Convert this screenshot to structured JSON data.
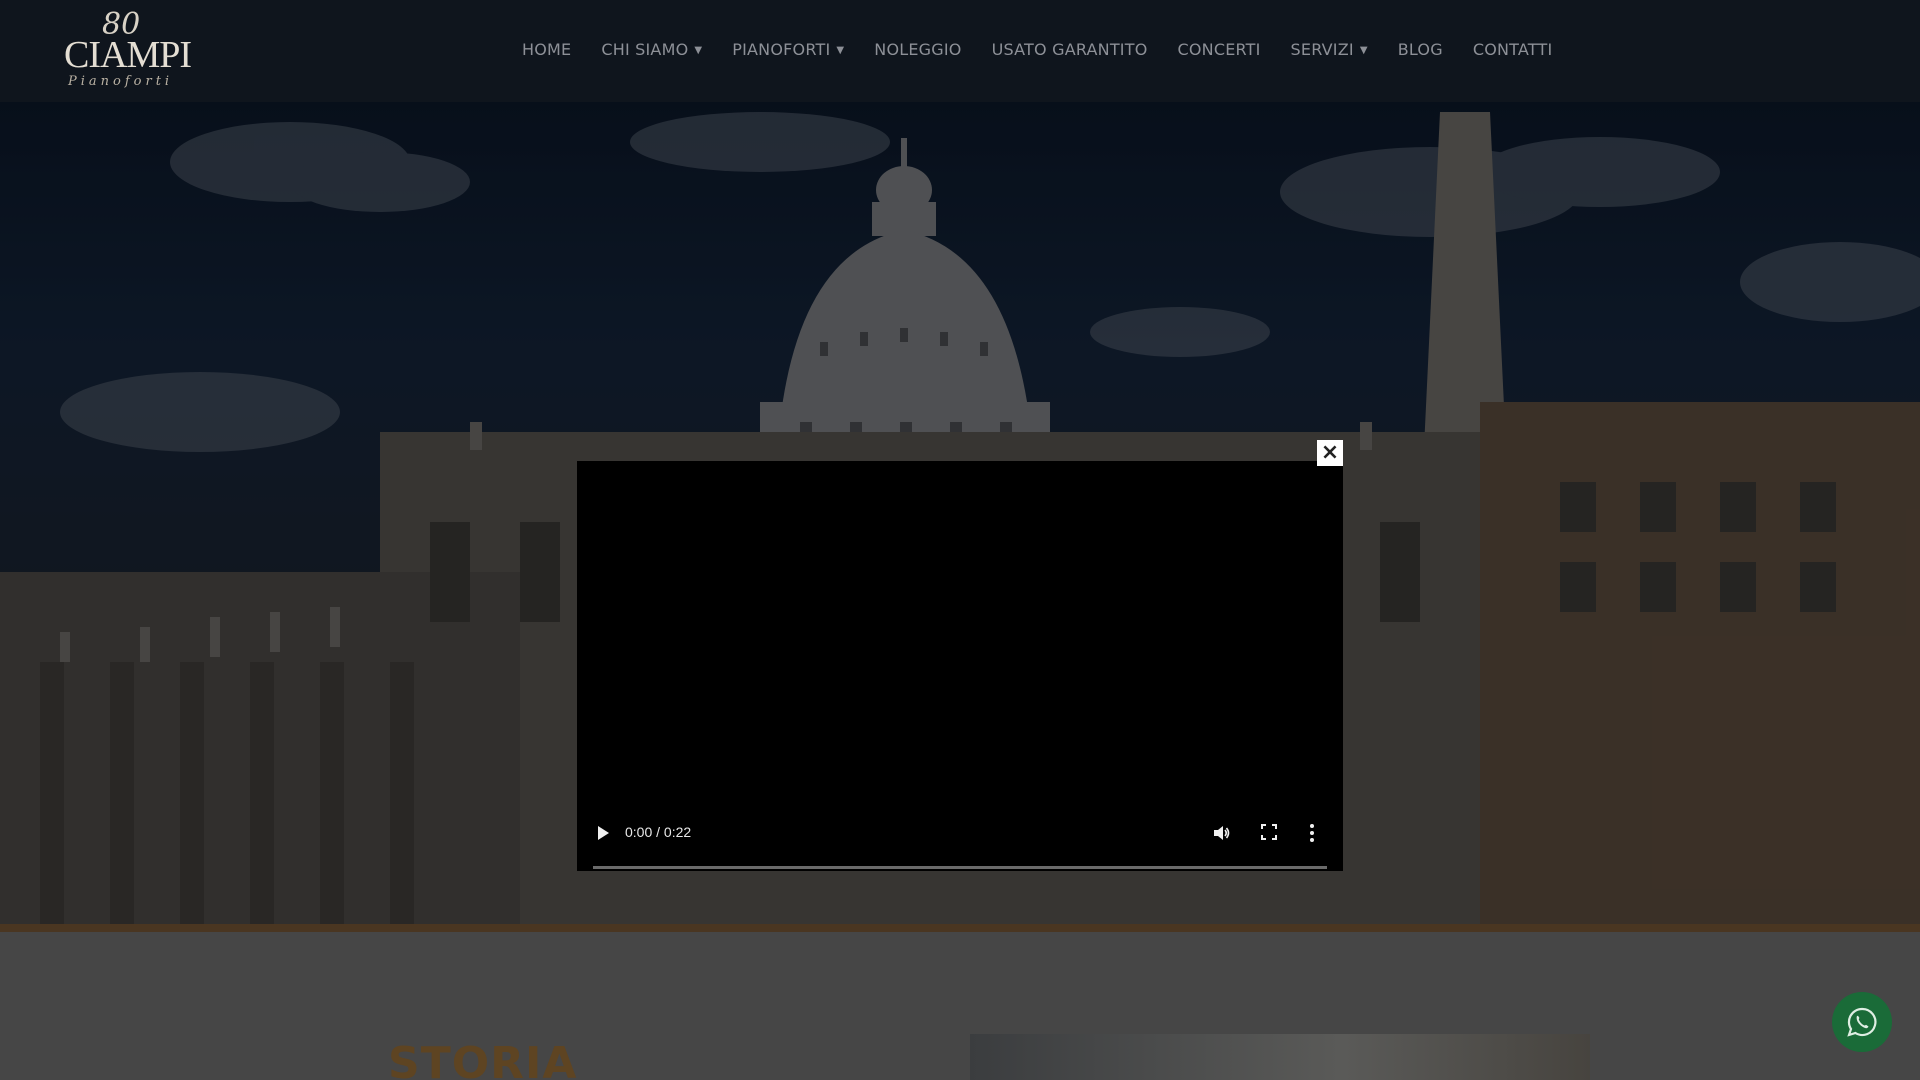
{
  "brand": {
    "logo_number": "80",
    "logo_name": "CIAMPI",
    "logo_subtitle": "Pianoforti"
  },
  "nav": {
    "items": [
      {
        "label": "HOME",
        "has_dropdown": false
      },
      {
        "label": "CHI SIAMO",
        "has_dropdown": true
      },
      {
        "label": "PIANOFORTI",
        "has_dropdown": true
      },
      {
        "label": "NOLEGGIO",
        "has_dropdown": false
      },
      {
        "label": "USATO GARANTITO",
        "has_dropdown": false
      },
      {
        "label": "CONCERTI",
        "has_dropdown": false
      },
      {
        "label": "SERVIZI",
        "has_dropdown": true
      },
      {
        "label": "BLOG",
        "has_dropdown": false
      },
      {
        "label": "CONTATTI",
        "has_dropdown": false
      }
    ]
  },
  "video": {
    "time": "0:00 / 0:22",
    "progress": 0,
    "close_symbol": "×",
    "icons": [
      "play-icon",
      "volume-icon",
      "fullscreen-icon",
      "more-options-icon"
    ]
  },
  "section": {
    "title": "STORIA"
  },
  "floating": {
    "icon": "whatsapp-icon"
  },
  "colors": {
    "header_bg": "#0f151d",
    "accent_brown": "#5e4422",
    "whatsapp_green": "#1a6b38",
    "nav_text": "#8d9097"
  }
}
